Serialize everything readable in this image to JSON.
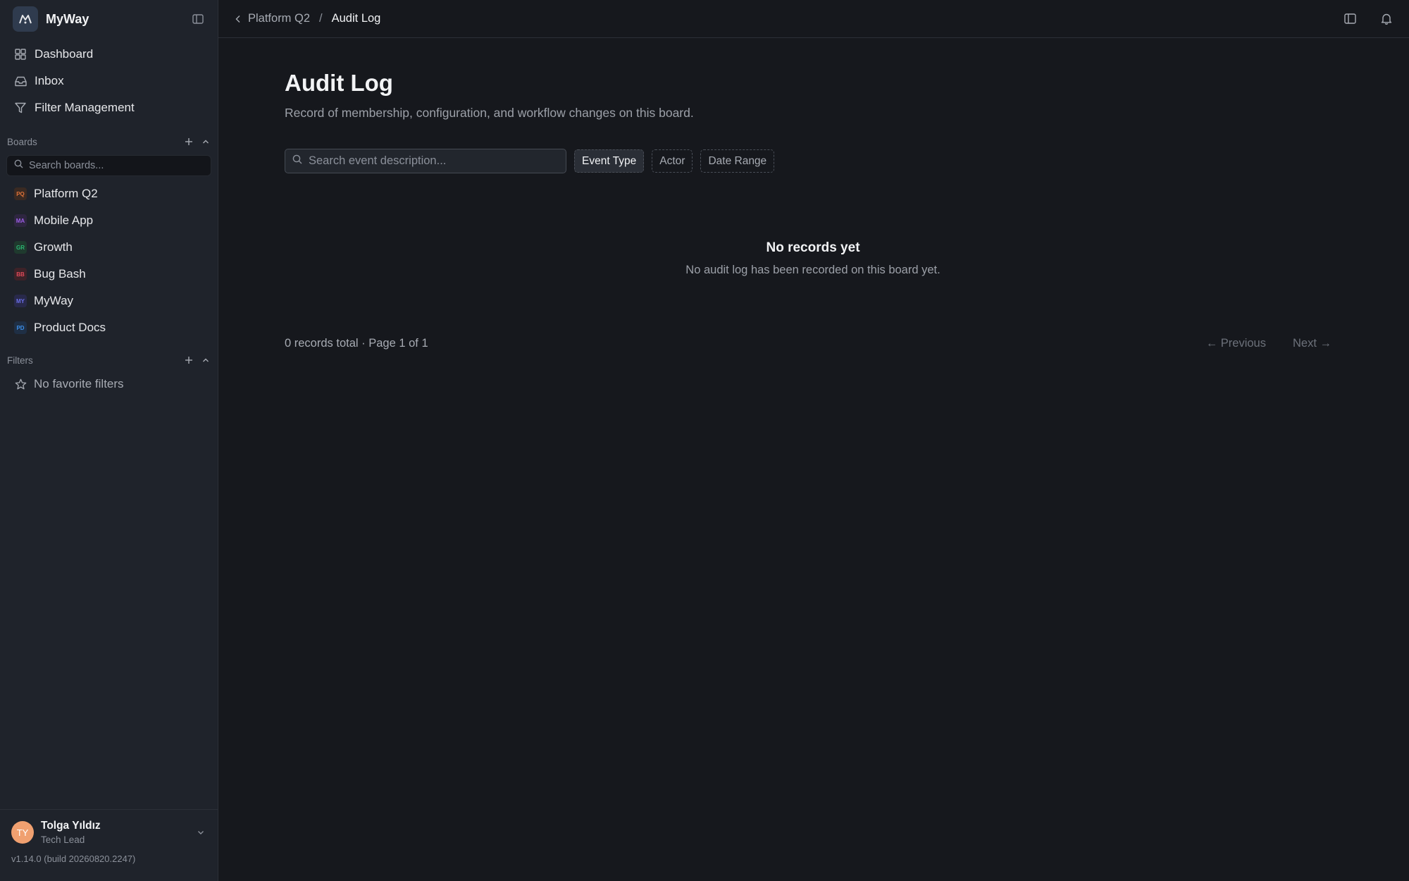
{
  "app": {
    "name": "MyWay",
    "logo_icon": "mountain-logo-icon"
  },
  "nav": [
    {
      "label": "Dashboard",
      "icon": "grid-icon"
    },
    {
      "label": "Inbox",
      "icon": "inbox-icon"
    },
    {
      "label": "Filter Management",
      "icon": "funnel-icon"
    }
  ],
  "boards_section": {
    "title": "Boards",
    "search_placeholder": "Search boards...",
    "items": [
      {
        "abbr": "PQ",
        "label": "Platform Q2",
        "color": "#e0733a",
        "bg": "#3a2a22"
      },
      {
        "abbr": "MA",
        "label": "Mobile App",
        "color": "#9b5de5",
        "bg": "#2e2640"
      },
      {
        "abbr": "GR",
        "label": "Growth",
        "color": "#2bb673",
        "bg": "#1f3a2e"
      },
      {
        "abbr": "BB",
        "label": "Bug Bash",
        "color": "#e04a5a",
        "bg": "#3d2228"
      },
      {
        "abbr": "MY",
        "label": "MyWay",
        "color": "#6b6fe8",
        "bg": "#28294a"
      },
      {
        "abbr": "PD",
        "label": "Product Docs",
        "color": "#3b8ee8",
        "bg": "#1f2f45"
      }
    ]
  },
  "filters_section": {
    "title": "Filters",
    "empty_label": "No favorite filters"
  },
  "user": {
    "initials": "TY",
    "name": "Tolga Yıldız",
    "role": "Tech Lead"
  },
  "version": "v1.14.0 (build 20260820.2247)",
  "breadcrumb": {
    "parent": "Platform Q2",
    "separator": "/",
    "current": "Audit Log"
  },
  "page": {
    "title": "Audit Log",
    "subtitle": "Record of membership, configuration, and workflow changes on this board."
  },
  "filters": {
    "search_placeholder": "Search event description...",
    "chips": [
      "Event Type",
      "Actor",
      "Date Range"
    ]
  },
  "empty_state": {
    "title": "No records yet",
    "message": "No audit log has been recorded on this board yet."
  },
  "pagination": {
    "summary": "0 records total · Page 1 of 1",
    "previous": "← Previous",
    "next": "Next →"
  }
}
